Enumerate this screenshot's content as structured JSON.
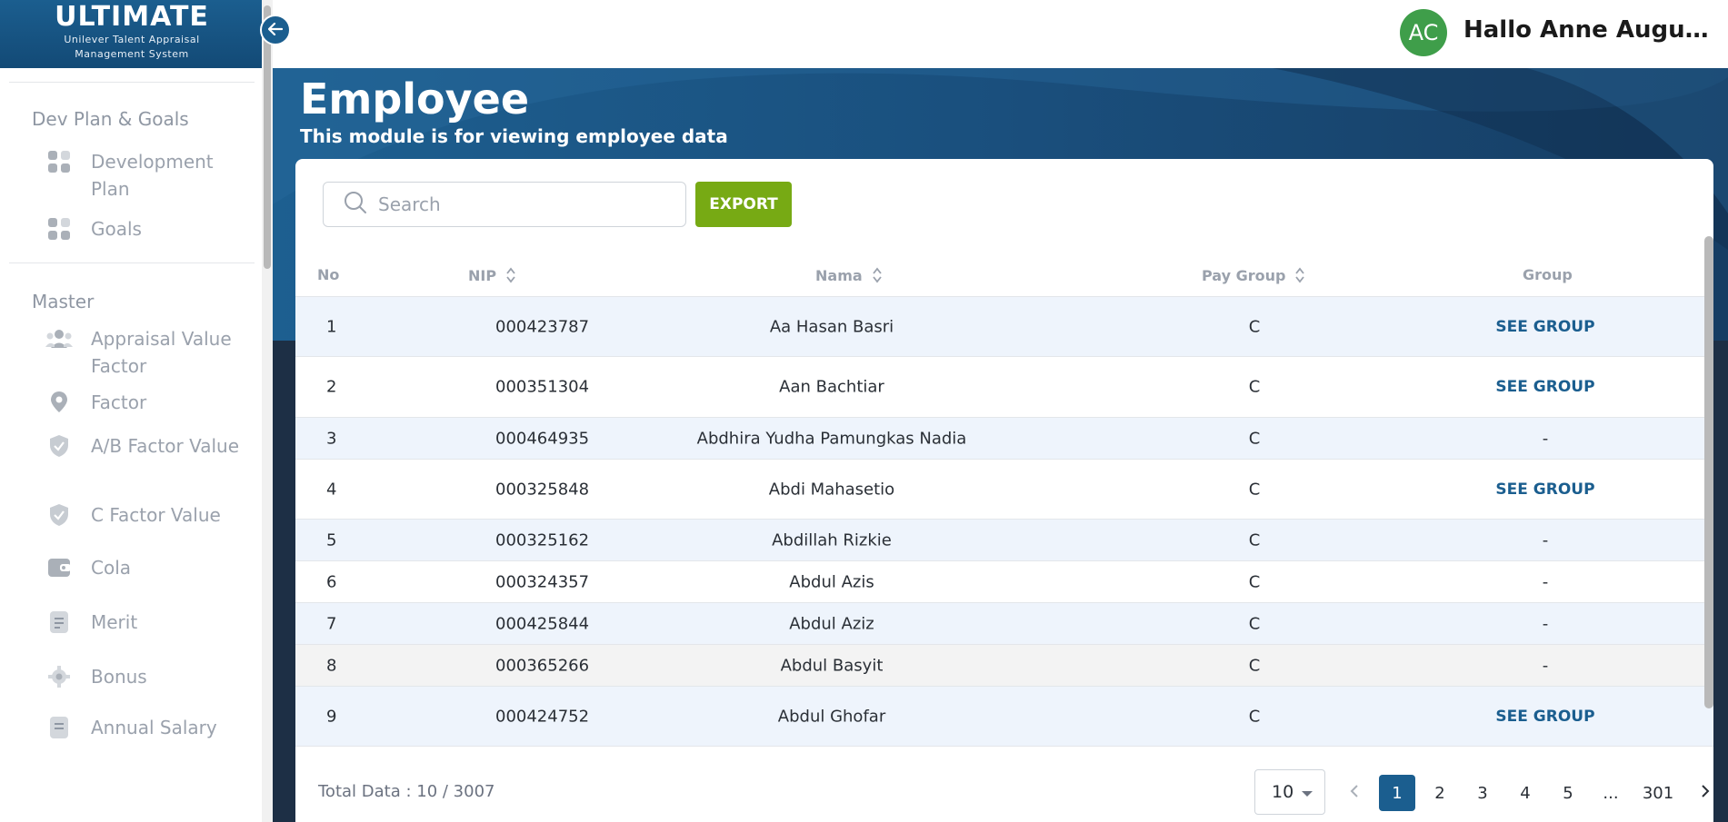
{
  "brand": {
    "title": "ULTIMATE",
    "subtitle_line1": "Unilever Talent Appraisal",
    "subtitle_line2": "Management System"
  },
  "header": {
    "avatar_initials": "AC",
    "greeting": "Hallo Anne Augusti..."
  },
  "page": {
    "title": "Employee",
    "subtitle": "This module is for viewing employee data"
  },
  "sidebar": {
    "section1": "Dev Plan & Goals",
    "items1": [
      {
        "label": "Development Plan",
        "icon": "grid-icon"
      },
      {
        "label": "Goals",
        "icon": "grid-icon"
      }
    ],
    "section2": "Master",
    "items2": [
      {
        "label": "Appraisal Value Factor",
        "icon": "users-icon"
      },
      {
        "label": "Factor",
        "icon": "pin-icon"
      },
      {
        "label": "A/B Factor Value",
        "icon": "shield-check-icon"
      },
      {
        "label": "C Factor Value",
        "icon": "shield-check-icon"
      },
      {
        "label": "Cola",
        "icon": "wallet-icon"
      },
      {
        "label": "Merit",
        "icon": "document-icon"
      },
      {
        "label": "Bonus",
        "icon": "gear-icon"
      },
      {
        "label": "Annual Salary",
        "icon": "document-icon"
      }
    ]
  },
  "toolbar": {
    "search_placeholder": "Search",
    "export_label": "EXPORT"
  },
  "table": {
    "columns": {
      "no": "No",
      "nip": "NIP",
      "nama": "Nama",
      "pay_group": "Pay Group",
      "group": "Group"
    },
    "rows": [
      {
        "no": "1",
        "nip": "000423787",
        "nama": "Aa Hasan Basri",
        "pay_group": "C",
        "group": "SEE GROUP"
      },
      {
        "no": "2",
        "nip": "000351304",
        "nama": "Aan Bachtiar",
        "pay_group": "C",
        "group": "SEE GROUP"
      },
      {
        "no": "3",
        "nip": "000464935",
        "nama": "Abdhira Yudha Pamungkas Nadia",
        "pay_group": "C",
        "group": "-"
      },
      {
        "no": "4",
        "nip": "000325848",
        "nama": "Abdi Mahasetio",
        "pay_group": "C",
        "group": "SEE GROUP"
      },
      {
        "no": "5",
        "nip": "000325162",
        "nama": "Abdillah Rizkie",
        "pay_group": "C",
        "group": "-"
      },
      {
        "no": "6",
        "nip": "000324357",
        "nama": "Abdul Azis",
        "pay_group": "C",
        "group": "-"
      },
      {
        "no": "7",
        "nip": "000425844",
        "nama": "Abdul Aziz",
        "pay_group": "C",
        "group": "-"
      },
      {
        "no": "8",
        "nip": "000365266",
        "nama": "Abdul Basyit",
        "pay_group": "C",
        "group": "-"
      },
      {
        "no": "9",
        "nip": "000424752",
        "nama": "Abdul Ghofar",
        "pay_group": "C",
        "group": "SEE GROUP"
      }
    ]
  },
  "footer": {
    "total": "Total Data : 10 / 3007",
    "page_size": "10",
    "pages": [
      "1",
      "2",
      "3",
      "4",
      "5",
      "...",
      "301"
    ],
    "current_page": "1"
  },
  "colors": {
    "brand": "#1b5e8f",
    "export": "#77aa14",
    "avatar": "#3f9e4a"
  }
}
